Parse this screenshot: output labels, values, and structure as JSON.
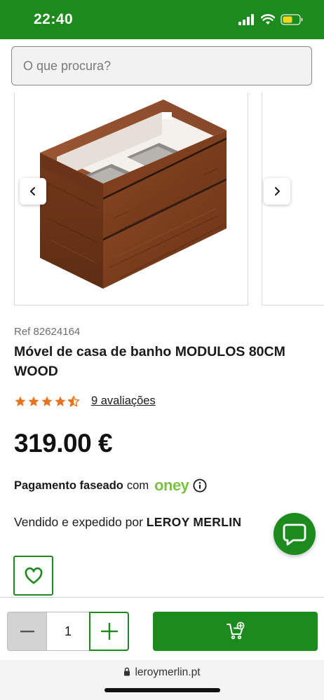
{
  "status_bar": {
    "time": "22:40",
    "icons": [
      "signal-icon",
      "wifi-icon",
      "battery-icon"
    ],
    "background": "#1d8a1d"
  },
  "search": {
    "placeholder": "O que procura?"
  },
  "carousel": {
    "slides": [
      {
        "image": "bathroom-vanity-wood-image"
      },
      {
        "image": "bathroom-vanity-wood-image-2"
      }
    ],
    "prev_icon": "chevron-left-icon",
    "next_icon": "chevron-right-icon"
  },
  "product": {
    "ref": "Ref 82624164",
    "title": "Móvel de casa de banho MODULOS 80CM WOOD",
    "rating": 4.5,
    "rating_max": 5,
    "reviews": "9 avaliações",
    "price": "319.00 €",
    "installments_bold": "Pagamento faseado",
    "installments_with": "com",
    "installments_brand": "oney",
    "seller_prefix": "Vendido e expedido por",
    "seller_name": "LEROY MERLIN"
  },
  "actions": {
    "chat_icon": "chat-bubble-icon",
    "wishlist_icon": "heart-icon",
    "quantity": "1",
    "cart_icon": "cart-add-icon"
  },
  "browser": {
    "url": "leroymerlin.pt",
    "lock_icon": "lock-icon"
  },
  "colors": {
    "brand_green": "#1d8a1d",
    "star_orange": "#e6731f",
    "oney_green": "#7bc242"
  }
}
